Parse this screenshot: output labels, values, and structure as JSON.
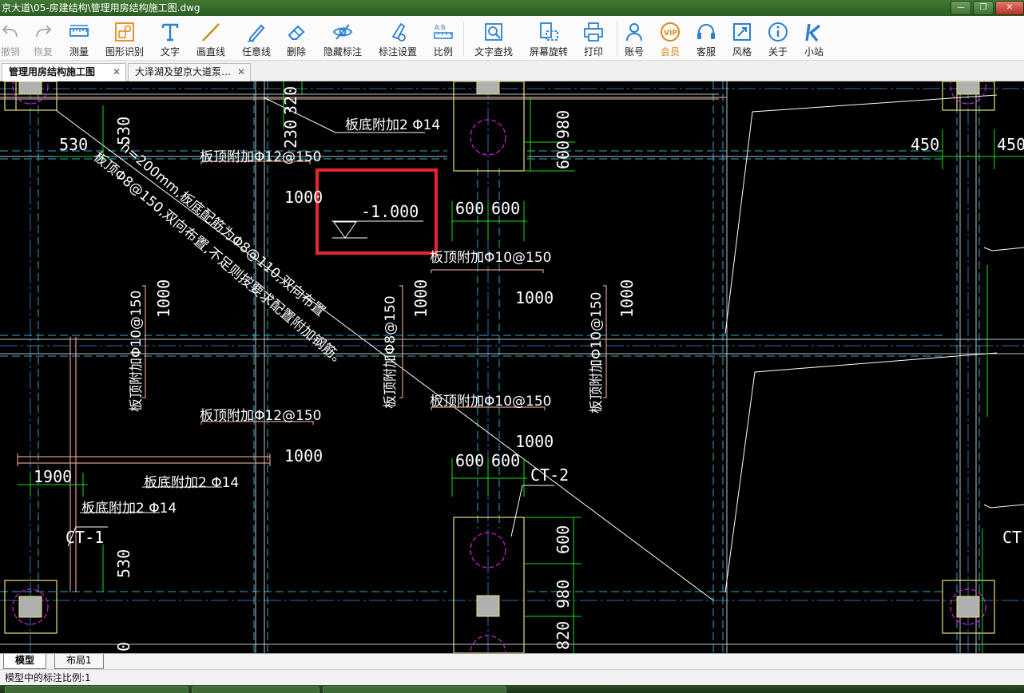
{
  "window": {
    "title": "京大道\\05-房建结构\\管理用房结构施工图.dwg",
    "controls": [
      "—",
      "❐",
      "✕"
    ]
  },
  "toolbar": {
    "undo": "撤销",
    "redo": "恢复",
    "measure": "测量",
    "recognize": "图形识别",
    "text": "文字",
    "line": "画直线",
    "freeline": "任意线",
    "erase": "删除",
    "hide_dim": "隐藏标注",
    "dim_settings": "标注设置",
    "scale": "比例",
    "text_search": "文字查找",
    "rotate": "屏幕旋转",
    "print": "打印",
    "account": "账号",
    "vip": "会员",
    "service": "客服",
    "style": "风格",
    "about": "关于",
    "site": "小站"
  },
  "tabs": [
    {
      "label": "管理用房结构施工图",
      "close": "✕",
      "active": true
    },
    {
      "label": "大泽湖及望京大道泵…",
      "close": "✕",
      "active": false
    }
  ],
  "drawing": {
    "labels": {
      "d530_top": "530",
      "d530_left": "530",
      "d320": "320",
      "d230": "230",
      "d980_top": "980",
      "d600_top": "600",
      "d450_a": "450",
      "d450_b": "450",
      "bottom_extra_top": "板底附加2 Φ14",
      "top_extra_12_top": "板顶附加Φ12@150",
      "d1000_a": "1000",
      "elevation": "-1.000",
      "d600_a": "600",
      "d600_b": "600",
      "top_extra_10_mid": "板顶附加Φ10@150",
      "note_line1": "h=200mm,板底配筋为Φ8@110,双向布置",
      "note_line2": "板顶Φ8@150,双向布置,不足则按要求配置附加钢筋。",
      "d1000_v1": "1000",
      "v_top_extra_10_left": "板顶附加Φ10@150",
      "d1000_v2": "1000",
      "v_top_extra_8": "板顶附加Φ8@150",
      "d1000_b": "1000",
      "d1000_v3": "1000",
      "v_top_extra_10_right": "板顶附加Φ10@150",
      "top_extra_12_low": "板顶附加Φ12@150",
      "top_extra_10_low": "板顶附加Φ10@150",
      "d1000_c": "1000",
      "d1000_d": "1000",
      "d600_c": "600",
      "d600_d": "600",
      "ct2": "CT-2",
      "d1900": "1900",
      "bottom_extra_a": "板底附加2 Φ14",
      "bottom_extra_b": "板底附加2 Φ14",
      "ct1": "CT-1",
      "ct_right": "CT",
      "d530_low": "530",
      "d600_low": "600",
      "d980_low": "980",
      "d820": "820",
      "d0": "0"
    },
    "colors": {
      "wall": "#e6e27a",
      "dim": "#18e018",
      "axis": "#2f6fb0",
      "hidden": "#35a7c9",
      "rebar": "#d89a8a",
      "text": "#ffffff",
      "circle": "#d41fd4",
      "highlight": "#e8262b"
    }
  },
  "layout_tabs": [
    "模型",
    "布局1"
  ],
  "status": {
    "text": "模型中的标注比例:1"
  }
}
